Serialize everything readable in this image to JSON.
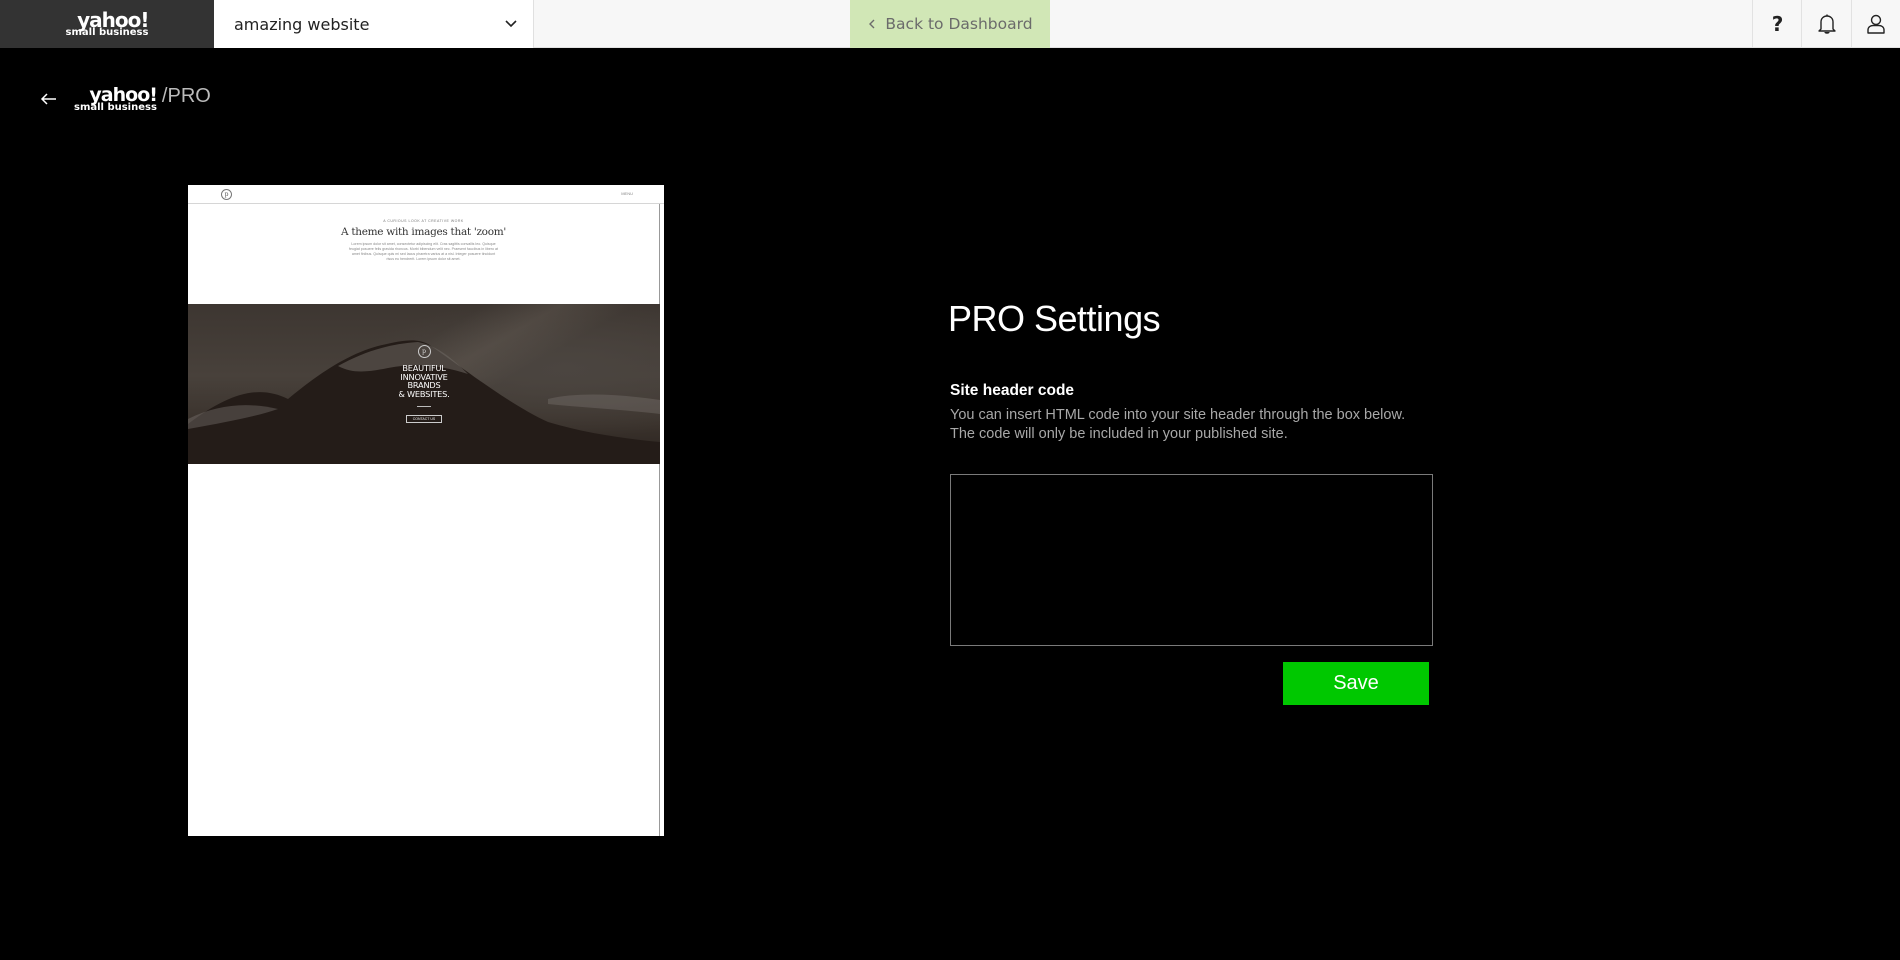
{
  "topbar": {
    "brand": {
      "line1": "yahoo!",
      "line2": "small business"
    },
    "site_selector": {
      "selected": "amazing website",
      "icon": "chevron-down-icon"
    },
    "back_button": {
      "label": "Back to Dashboard",
      "icon": "chevron-left-icon",
      "bg_color": "#d1e7b6"
    },
    "icons": [
      {
        "name": "help-icon",
        "glyph": "?"
      },
      {
        "name": "bell-icon"
      },
      {
        "name": "user-icon"
      }
    ]
  },
  "subheader": {
    "back_icon": "arrow-left-icon",
    "brand": {
      "line1": "yahoo!",
      "line2": "small business"
    },
    "suffix": "/PRO"
  },
  "preview": {
    "nav": {
      "logo_glyph": "p",
      "menu_label": "MENU"
    },
    "intro": {
      "kicker": "A CURIOUS LOOK AT CREATIVE WORK",
      "title": "A theme with images that 'zoom'",
      "body": "Lorem ipsum dolor sit amet, consectetur adipiscing elit. Cras sagittis convallis leo. Quisque feugiat posuere felis gravida rhoncus. Morbi bibendum velit nec. Praesent faucibus in libero at amet finibus. Quisque quis mi sed lacus pharetra varius at a nisl. Integer posuere tincidunt risus eu hendrerit. Lorem ipsum dolor sit amet."
    },
    "hero": {
      "logo_glyph": "p",
      "headline": [
        "BEAUTIFUL",
        "INNOVATIVE",
        "BRANDS",
        "& WEBSITES."
      ],
      "button_label": "CONTACT US"
    }
  },
  "settings": {
    "title": "PRO Settings",
    "field_label": "Site header code",
    "help_line1": "You can insert HTML code into your site header through the box below.",
    "help_line2": "The code will only be included in your published site.",
    "code_value": "",
    "save_label": "Save",
    "save_color": "#00c800"
  }
}
